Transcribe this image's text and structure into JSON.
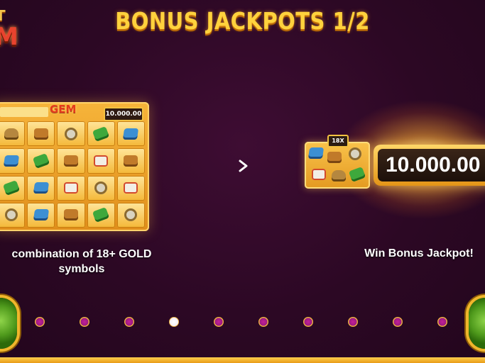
{
  "header": {
    "title": "BONUS JACKPOTS 1/2"
  },
  "logo": {
    "line1": "T",
    "line2": "M"
  },
  "left_panel": {
    "board_label": "GEM",
    "board_value": "10.000.00",
    "caption_line1": "combination of 18+ GOLD",
    "caption_line2": "symbols",
    "grid_symbols": [
      [
        "bag",
        "pouch",
        "watch",
        "leaf",
        "book"
      ],
      [
        "book",
        "leaf",
        "pouch",
        "shirt",
        "pouch"
      ],
      [
        "leaf",
        "book",
        "shirt",
        "watch",
        "shirt"
      ],
      [
        "watch",
        "book",
        "pouch",
        "leaf",
        "watch"
      ]
    ]
  },
  "right_panel": {
    "mini_tag": "18X",
    "jackpot_value": "10.000.00",
    "caption": "Win Bonus Jackpot!"
  },
  "navigation": {
    "page_count": 10,
    "active_index": 3
  },
  "colors": {
    "background": "#2c0824",
    "title": "#ffd23d",
    "gold": "#f3c241",
    "dot": "#b31d8e",
    "nav_button": "#4f9a1c"
  }
}
